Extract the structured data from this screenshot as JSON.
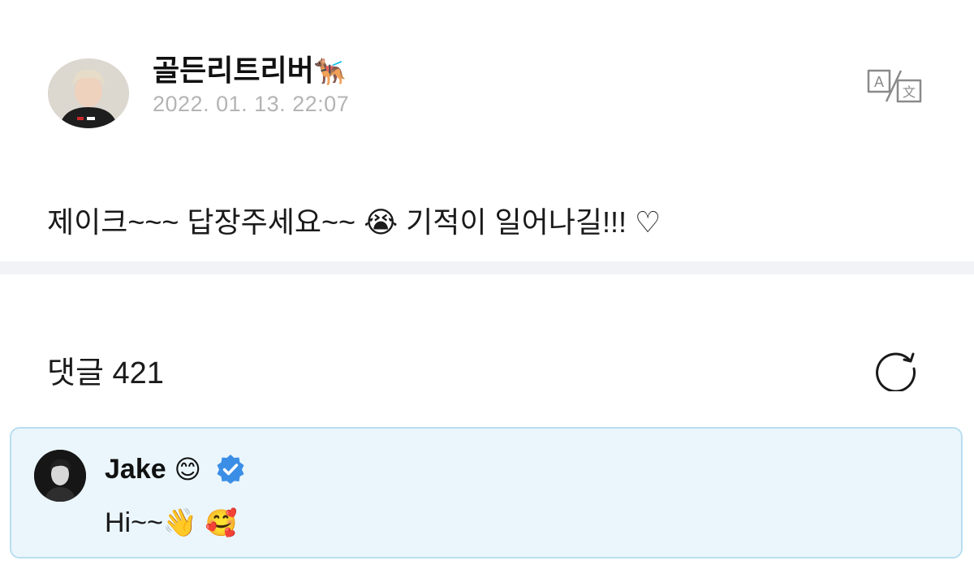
{
  "post": {
    "author_name": "골든리트리버",
    "author_emoji": "🐕‍🦺",
    "date": "2022. 01. 13. 22:07",
    "body": "제이크~~~ 답장주세요~~ 😭 기적이 일어나길!!! ♡"
  },
  "toolbar": {
    "translate_icon": "translate-icon"
  },
  "comments": {
    "label": "댓글",
    "count": "421",
    "refresh_icon": "refresh-icon",
    "items": [
      {
        "author": "Jake",
        "author_emoji": "😊",
        "verified": true,
        "text": "Hi~~👋",
        "text_emoji": "🥰"
      }
    ]
  },
  "colors": {
    "date": "#b4b4b4",
    "comment_bg": "#eaf6fc",
    "comment_border": "#b9def0",
    "verified": "#3b8ee6"
  }
}
